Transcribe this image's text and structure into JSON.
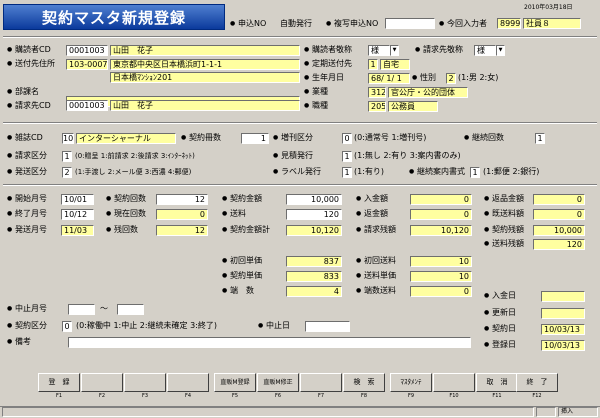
{
  "title": "契約マスタ新規登録",
  "date": "2010年03月18日",
  "header": {
    "order_no_label": "申込NO",
    "order_no_value": "自動発行",
    "copy_order_label": "複写申込NO",
    "copy_order_value": "",
    "inputter_label": "今回入力者",
    "inputter_code": "8999",
    "inputter_name": "社員８"
  },
  "buyer": {
    "cd_label": "購読者CD",
    "cd": "0001003",
    "name": "山田　花子",
    "honorific_label": "購読者敬称",
    "honorific": "様",
    "request_honorific_label": "請求先敬称",
    "request_honorific": "様",
    "ship_label": "送付先住所",
    "zip": "103-0007",
    "addr1": "東京都中央区日本橋浜町1-1-1",
    "addr2": "日本橋ﾏﾝｼｮﾝ201",
    "fixed_ship_label": "定期送付先",
    "fixed_ship_code": "1",
    "fixed_ship_name": "自宅",
    "birth_label": "生年月日",
    "birth": "68/ 1/ 1",
    "gender_label": "性別",
    "gender": "2",
    "gender_hint": "(1:男 2:女)",
    "dept_label": "部課名",
    "dept": "",
    "industry_label": "業種",
    "industry_code": "312",
    "industry_name": "官公庁・公的団体",
    "billing_label": "請求先CD",
    "billing_cd": "0001003",
    "billing_name": "山田　花子",
    "job_label": "職種",
    "job_code": "205",
    "job_name": "公務員"
  },
  "magazine": {
    "cd_label": "雑誌CD",
    "cd": "10",
    "name": "インターシャーナル",
    "copies_label": "契約冊数",
    "copies": "1",
    "increase_label": "増刊区分",
    "increase": "0",
    "increase_hint": "(0:通常号 1:増刊号)",
    "continue_label": "継続回数",
    "continue": "1",
    "billing_div_label": "請求区分",
    "billing_div": "1",
    "billing_div_hint": "(0:贈呈 1:前請求 2:後請求 3:ｲﾝﾀｰﾈｯﾄ)",
    "estimate_label": "見積発行",
    "estimate": "1",
    "estimate_hint": "(1:無し 2:有り 3:案内書のみ)",
    "ship_div_label": "発送区分",
    "ship_div": "2",
    "ship_div_hint": "(1:手渡し 2:メール便 3:西濃 4:郵便)",
    "label_label": "ラベル発行",
    "label": "1",
    "label_hint": "(1:有り)",
    "guide_label": "継続案内書式",
    "guide": "1",
    "guide_hint": "(1:郵便 2:銀行)"
  },
  "terms": {
    "start_label": "開始月号",
    "start": "10/01",
    "end_label": "終了月号",
    "end": "10/12",
    "sent_label": "発送月号",
    "sent": "11/03",
    "count_label": "契約回数",
    "count": "12",
    "current_label": "現在回数",
    "current": "0",
    "remain_label": "残回数",
    "remain": "12",
    "amount_label": "契約金額",
    "amount": "10,000",
    "shipping_label": "送料",
    "shipping": "120",
    "total_label": "契約金額計",
    "total": "10,120",
    "paid_label": "入金額",
    "paid": "0",
    "refund_label": "返金額",
    "refund": "0",
    "billing_remain_label": "請求残額",
    "billing_remain": "10,120",
    "return_label": "返品金額",
    "return": "0",
    "issued_label": "既送料額",
    "issued": "0",
    "contract_remain_label": "契約残額",
    "contract_remain": "10,000",
    "ship_remain_label": "送料残額",
    "ship_remain": "120",
    "first_price_label": "初回単価",
    "first_price": "837",
    "first_ship_label": "初回送料",
    "first_ship": "10",
    "unit_price_label": "契約単価",
    "unit_price": "833",
    "unit_ship_label": "送料単価",
    "unit_ship": "10",
    "fraction_label": "端　数",
    "fraction": "4",
    "fraction_ship_label": "端数送料",
    "fraction_ship": "0",
    "paid_date_label": "入金日",
    "paid_date": "",
    "update_label": "更新日",
    "update": "",
    "contract_date_label": "契約日",
    "contract_date": "10/03/13",
    "register_label": "登録日",
    "register": "10/03/13"
  },
  "stop": {
    "stop_month_label": "中止月号",
    "stop_from": "",
    "tilde": "～",
    "stop_to": "",
    "status_label": "契約区分",
    "status": "0",
    "status_hint": "(0:稼働中 1:中止 2:継続未確定 3:終了)",
    "stop_date_label": "中止日",
    "stop_date": "",
    "memo_label": "備考",
    "memo": ""
  },
  "fkeys": [
    {
      "label": "登　録",
      "key": "F1"
    },
    {
      "label": "",
      "key": "F2"
    },
    {
      "label": "",
      "key": "F3"
    },
    {
      "label": "",
      "key": "F4"
    },
    {
      "label": "直販M登録",
      "key": "F5"
    },
    {
      "label": "直販M修正",
      "key": "F6"
    },
    {
      "label": "",
      "key": "F7"
    },
    {
      "label": "検　索",
      "key": "F8"
    },
    {
      "label": "ﾏｽﾀﾒﾝﾃ",
      "key": "F9"
    },
    {
      "label": "",
      "key": "F10"
    },
    {
      "label": "取　消",
      "key": "F11"
    },
    {
      "label": "終　了",
      "key": "F12"
    }
  ],
  "status_bar": {
    "mode": "挿入"
  }
}
